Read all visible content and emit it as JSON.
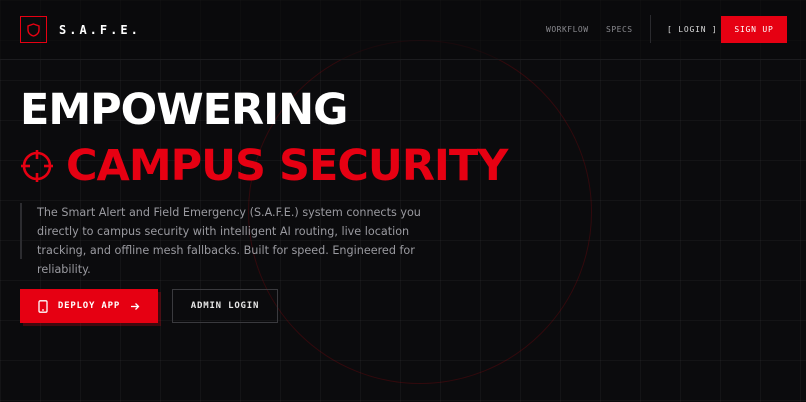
{
  "brand": {
    "name": "S.A.F.E.",
    "icon": "shield-icon",
    "accent_color": "#e60012"
  },
  "nav": {
    "links": [
      "WORKFLOW",
      "SPECS"
    ],
    "login_label": "[ LOGIN ]",
    "signup_label": "SIGN UP"
  },
  "hero": {
    "title_line1": "EMPOWERING",
    "title_line2": "CAMPUS SECURITY",
    "title_icon": "crosshair-icon",
    "description": "The Smart Alert and Field Emergency (S.A.F.E.) system connects you directly to campus security with intelligent AI routing, live location tracking, and offline mesh fallbacks. Built for speed. Engineered for reliability.",
    "primary_cta": {
      "label": "DEPLOY APP",
      "icon": "phone-icon",
      "trailing_icon": "arrow-right-icon"
    },
    "secondary_cta": {
      "label": "ADMIN LOGIN"
    }
  }
}
